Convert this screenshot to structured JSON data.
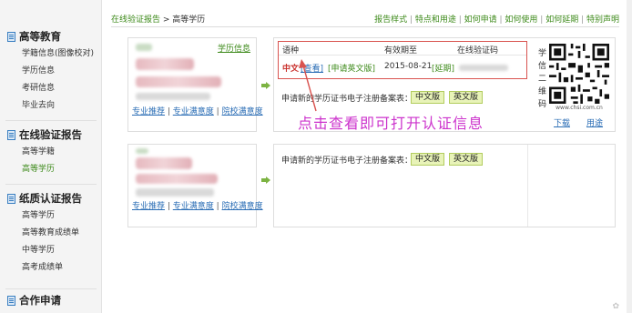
{
  "sidebar": {
    "sections": [
      {
        "title": "高等教育",
        "items": [
          "学籍信息(图像校对)",
          "学历信息",
          "考研信息",
          "毕业去向"
        ]
      },
      {
        "title": "在线验证报告",
        "items": [
          "高等学籍",
          "高等学历"
        ],
        "active": "高等学历"
      },
      {
        "title": "纸质认证报告",
        "items": [
          "高等学历",
          "高等教育成绩单",
          "中等学历",
          "高考成绩单"
        ]
      },
      {
        "title": "合作申请",
        "items": []
      }
    ]
  },
  "breadcrumb": {
    "link": "在线验证报告",
    "sep": " > ",
    "current": "高等学历"
  },
  "top_links": [
    "报告样式",
    "特点和用途",
    "如何申请",
    "如何使用",
    "如何延期",
    "特别声明"
  ],
  "record1": {
    "edu_link": "学历信息",
    "bottom_links": [
      "专业推荐",
      "专业满意度",
      "院校满意度"
    ],
    "table": {
      "headers": {
        "lang": "语种",
        "valid": "有效期至",
        "code": "在线验证码"
      },
      "row": {
        "lang": "中文",
        "view": "[查看]",
        "apply_en": "[申请英文版]",
        "date": "2015-08-21",
        "extend": "[延期]"
      }
    },
    "register_text": "申请新的学历证书电子注册备案表：",
    "btn_cn": "中文版",
    "btn_en": "英文版",
    "annotation": "点击查看即可打开认证信息",
    "qr": {
      "side_text": [
        "学",
        "信",
        "二",
        "维",
        "码"
      ],
      "caption": "www.chsi.com.cn",
      "links": [
        "下载",
        "用途"
      ]
    }
  },
  "record2": {
    "bottom_links": [
      "专业推荐",
      "专业满意度",
      "院校满意度"
    ],
    "register_text": "申请新的学历证书电子注册备案表：",
    "btn_cn": "中文版",
    "btn_en": "英文版"
  },
  "colors": {
    "green": "#3d8a1a",
    "blue": "#2a6db5",
    "red": "#c9302c",
    "annotation": "#cc33cc",
    "button_bg": "#e8f3b8"
  }
}
